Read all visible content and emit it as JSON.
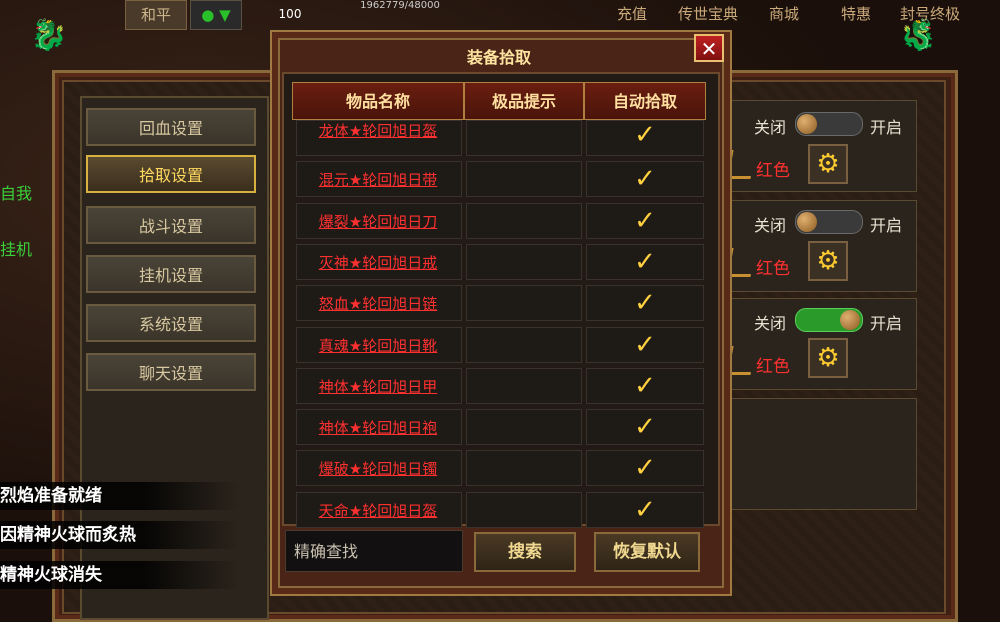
{
  "topbar": {
    "mode_label": "和平",
    "level_value": "100",
    "exp_text": "1962779/48000",
    "menu": [
      "充值",
      "传世宝典",
      "商城",
      "特惠",
      "封号终极"
    ]
  },
  "background_hud": {
    "left_texts": [
      "自我",
      "挂机"
    ],
    "chat_lines": [
      "烈焰准备就绪",
      "因精神火球而炙热",
      "精神火球消失"
    ]
  },
  "settings_nav": {
    "items": [
      "回血设置",
      "拾取设置",
      "战斗设置",
      "挂机设置",
      "系统设置",
      "聊天设置"
    ],
    "active_index": 1
  },
  "right_settings": [
    {
      "off_label": "关闭",
      "on_label": "开启",
      "enabled": false,
      "color_label": "红色"
    },
    {
      "off_label": "关闭",
      "on_label": "开启",
      "enabled": false,
      "color_label": "红色"
    },
    {
      "off_label": "关闭",
      "on_label": "开启",
      "enabled": true,
      "color_label": "红色"
    }
  ],
  "modal": {
    "title": "装备拾取",
    "columns": [
      "物品名称",
      "极品提示",
      "自动拾取"
    ],
    "items": [
      {
        "name": "龙体★轮回旭日盔",
        "auto_pickup": true
      },
      {
        "name": "混元★轮回旭日带",
        "auto_pickup": true
      },
      {
        "name": "爆裂★轮回旭日刀",
        "auto_pickup": true
      },
      {
        "name": "灭神★轮回旭日戒",
        "auto_pickup": true
      },
      {
        "name": "怒血★轮回旭日链",
        "auto_pickup": true
      },
      {
        "name": "真魂★轮回旭日靴",
        "auto_pickup": true
      },
      {
        "name": "神体★轮回旭日甲",
        "auto_pickup": true
      },
      {
        "name": "神体★轮回旭日袍",
        "auto_pickup": true
      },
      {
        "name": "爆破★轮回旭日镯",
        "auto_pickup": true
      },
      {
        "name": "天命★轮回旭日盔",
        "auto_pickup": true
      }
    ],
    "search_placeholder": "精确查找",
    "search_button": "搜索",
    "reset_button": "恢复默认",
    "close_glyph": "✕",
    "check_glyph": "✓"
  },
  "colors": {
    "item_red": "#ff3030",
    "gold": "#ffd040",
    "toggle_on": "#2a9a2a"
  }
}
